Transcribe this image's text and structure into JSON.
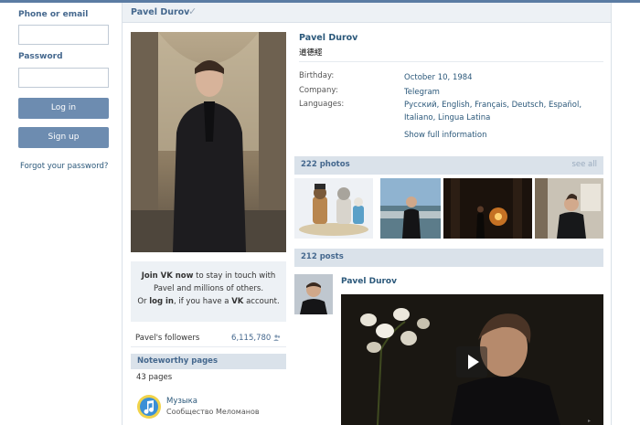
{
  "login": {
    "phone_label": "Phone or email",
    "password_label": "Password",
    "login_button": "Log in",
    "signup_button": "Sign up",
    "forgot_link": "Forgot your password?"
  },
  "header": {
    "name": "Pavel Durov",
    "verified_mark": "✓"
  },
  "profile": {
    "name": "Pavel Durov",
    "status": "道德經",
    "info": [
      {
        "key": "Birthday:",
        "value": "October 10, 1984"
      },
      {
        "key": "Company:",
        "value": "Telegram"
      },
      {
        "key": "Languages:",
        "value": "Русский, English, Français, Deutsch, Español, Italiano, Lingua Latina"
      }
    ],
    "show_full": "Show full information"
  },
  "photos": {
    "title": "222 photos",
    "see_all": "see all"
  },
  "posts": {
    "title": "212 posts",
    "first_author": "Pavel Durov"
  },
  "join": {
    "part1": "Join VK now",
    "part2": " to stay in touch with Pavel and millions of others.",
    "part3": "Or ",
    "part4": "log in",
    "part5": ", if you have a ",
    "part6": "VK",
    "part7": " account."
  },
  "followers": {
    "label": "Pavel's followers",
    "count": "6,115,780"
  },
  "noteworthy": {
    "title": "Noteworthy pages",
    "count": "43 pages",
    "page_name": "Музыка",
    "page_sub": "Сообщество Меломанов"
  },
  "icons": {
    "verified": "checkmark-icon",
    "followers": "people-icon",
    "music": "music-note-icon",
    "video": "play-icon"
  },
  "colors": {
    "accent": "#45688e",
    "link": "#2b587a",
    "button": "#6d8cb0",
    "bar": "#dae2ea",
    "header_bg": "#edf1f5"
  }
}
